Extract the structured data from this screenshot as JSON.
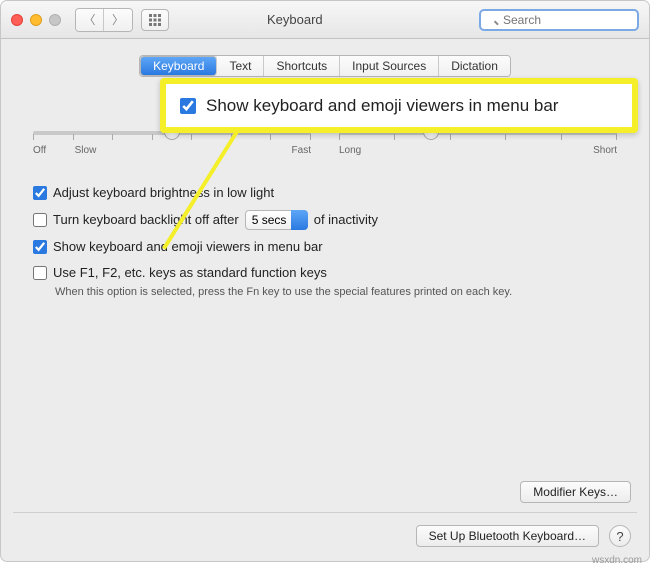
{
  "title": "Keyboard",
  "search_placeholder": "Search",
  "tabs": [
    "Keyboard",
    "Text",
    "Shortcuts",
    "Input Sources",
    "Dictation"
  ],
  "slider1": {
    "left": "Off",
    "left2": "Slow",
    "right": "Fast"
  },
  "slider2": {
    "left": "Long",
    "right": "Short"
  },
  "opt": {
    "brightness": "Adjust keyboard brightness in low light",
    "backlight_a": "Turn keyboard backlight off after",
    "backlight_sel": "5 secs",
    "backlight_b": "of inactivity",
    "emoji": "Show keyboard and emoji viewers in menu bar",
    "fn": "Use F1, F2, etc. keys as standard function keys",
    "fn_sub": "When this option is selected, press the Fn key to use the special features printed on each key."
  },
  "callout": "Show keyboard and emoji viewers in menu bar",
  "modifier": "Modifier Keys…",
  "bluetooth": "Set Up Bluetooth Keyboard…",
  "help": "?",
  "watermark": "wsxdn.com"
}
